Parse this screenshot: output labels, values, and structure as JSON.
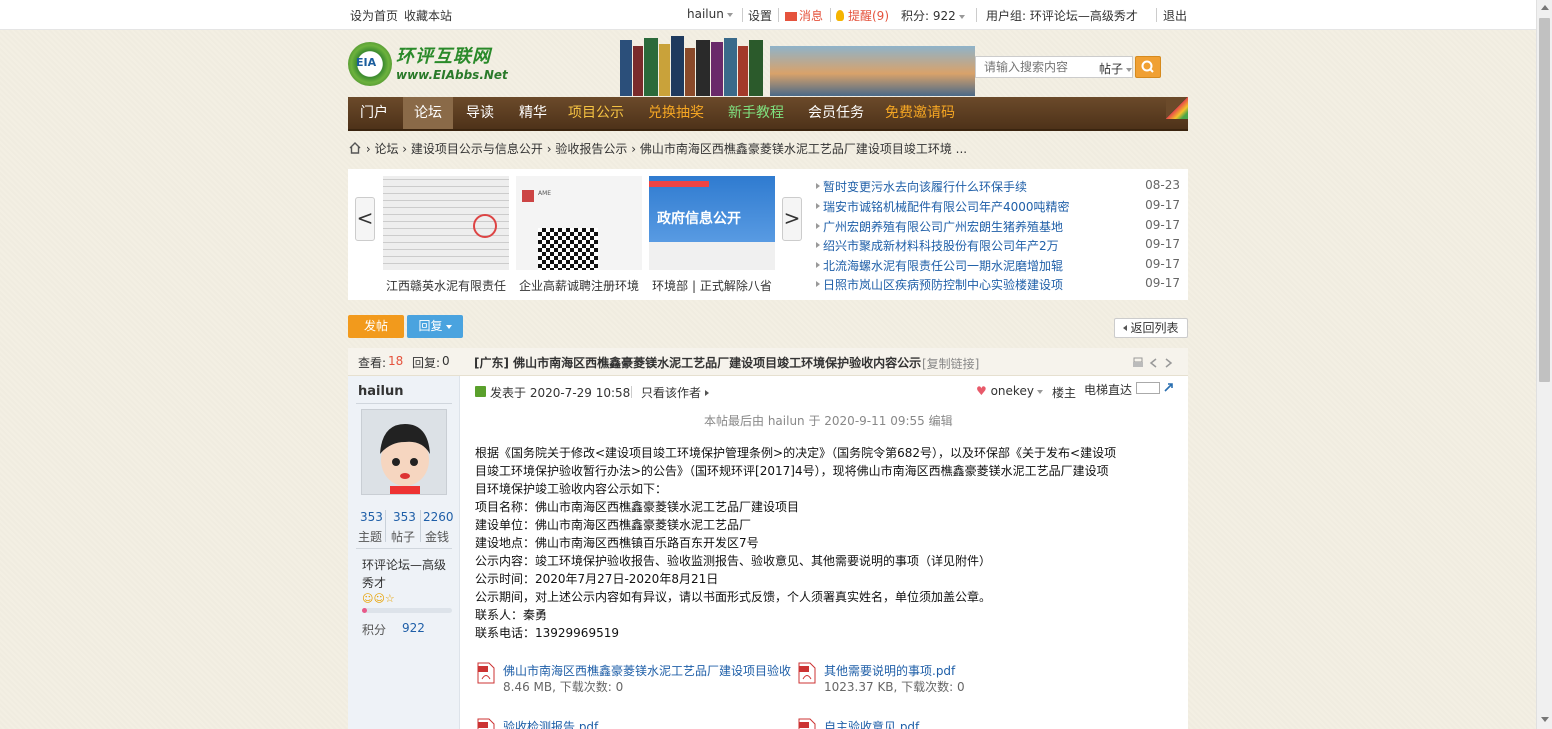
{
  "topbar": {
    "set_home": "设为首页",
    "bookmark": "收藏本站",
    "username": "hailun",
    "settings": "设置",
    "messages": "消息",
    "reminders": "提醒(9)",
    "points": "积分: 922",
    "usergroup": "用户组: 环评论坛—高级秀才",
    "logout": "退出"
  },
  "logo": {
    "cn": "环评互联网",
    "en": "www.EIAbbs.Net",
    "badge": "EIA"
  },
  "search": {
    "placeholder": "请输入搜索内容",
    "scope": "帖子"
  },
  "nav": [
    "门户",
    "论坛",
    "导读",
    "精华",
    "项目公示",
    "兑换抽奖",
    "新手教程",
    "会员任务",
    "免费邀请码"
  ],
  "breadcrumb": {
    "forum": "论坛",
    "cat1": "建设项目公示与信息公开",
    "cat2": "验收报告公示",
    "current": "佛山市南海区西樵鑫豪菱镁水泥工艺品厂建设项目竣工环境 ..."
  },
  "slider": {
    "prev": "<",
    "next": ">",
    "captions": [
      "江西赣英水泥有限责任",
      "企业高薪诚聘注册环境",
      "环境部 | 正式解除八省"
    ],
    "gov_banner": "政府信息公开",
    "ame_name": "AME"
  },
  "news": [
    {
      "title": "暂时变更污水去向该履行什么环保手续",
      "date": "08-23"
    },
    {
      "title": "瑞安市诚铭机械配件有限公司年产4000吨精密",
      "date": "09-17"
    },
    {
      "title": "广州宏朗养殖有限公司广州宏朗生猪养殖基地",
      "date": "09-17"
    },
    {
      "title": "绍兴市聚成新材料科技股份有限公司年产2万",
      "date": "09-17"
    },
    {
      "title": "北流海螺水泥有限责任公司一期水泥磨增加辊",
      "date": "09-17"
    },
    {
      "title": "日照市岚山区疾病预防控制中心实验楼建设项",
      "date": "09-17"
    }
  ],
  "actions": {
    "post": "发帖",
    "reply": "回复",
    "back": "返回列表"
  },
  "thread": {
    "views_label": "查看:",
    "views": "18",
    "replies_label": "回复:",
    "replies": "0",
    "title": "[广东] 佛山市南海区西樵鑫豪菱镁水泥工艺品厂建设项目竣工环境保护验收内容公示",
    "copy_link": "[复制链接]"
  },
  "author": {
    "name": "hailun",
    "threads": "353",
    "threads_label": "主题",
    "posts": "353",
    "posts_label": "帖子",
    "coins": "2260",
    "coins_label": "金钱",
    "group": "环评论坛—高级",
    "group2": "秀才",
    "points_label": "积分",
    "points": "922",
    "rank_progress": 0.05
  },
  "post": {
    "posted": "发表于 2020-7-29 10:58",
    "author_only": "只看该作者",
    "onekey": "onekey",
    "floor": "楼主",
    "elevator": "电梯直达",
    "edited": "本帖最后由 hailun 于 2020-9-11 09:55 编辑",
    "lines": [
      "根据《国务院关于修改<建设项目竣工环境保护管理条例>的决定》（国务院令第682号），以及环保部《关于发布<建设项",
      "目竣工环境保护验收暂行办法>的公告》（国环规环评[2017]4号），现将佛山市南海区西樵鑫豪菱镁水泥工艺品厂建设项",
      "目环境保护竣工验收内容公示如下：",
      "项目名称：佛山市南海区西樵鑫豪菱镁水泥工艺品厂建设项目",
      "建设单位：佛山市南海区西樵鑫豪菱镁水泥工艺品厂",
      "建设地点：佛山市南海区西樵镇百乐路百东开发区7号",
      "公示内容：竣工环境保护验收报告、验收监测报告、验收意见、其他需要说明的事项（详见附件）",
      "公示时间：2020年7月27日-2020年8月21日",
      "公示期间，对上述公示内容如有异议，请以书面形式反馈，个人须署真实姓名，单位须加盖公章。",
      "联系人：秦勇",
      "联系电话：13929969519"
    ]
  },
  "attachments": [
    {
      "name": "佛山市南海区西樵鑫豪菱镁水泥工艺品厂建设项目验收",
      "meta": "8.46 MB, 下载次数: 0"
    },
    {
      "name": "其他需要说明的事项.pdf",
      "meta": "1023.37 KB, 下载次数: 0"
    },
    {
      "name": "验收检测报告.pdf",
      "meta": ""
    },
    {
      "name": "自主验收意见.pdf",
      "meta": ""
    }
  ],
  "colors": {
    "nav_bg": "#5c3d21",
    "accent_orange": "#f29a1c",
    "link_blue": "#1f5fa8",
    "views_red": "#e5533d"
  }
}
